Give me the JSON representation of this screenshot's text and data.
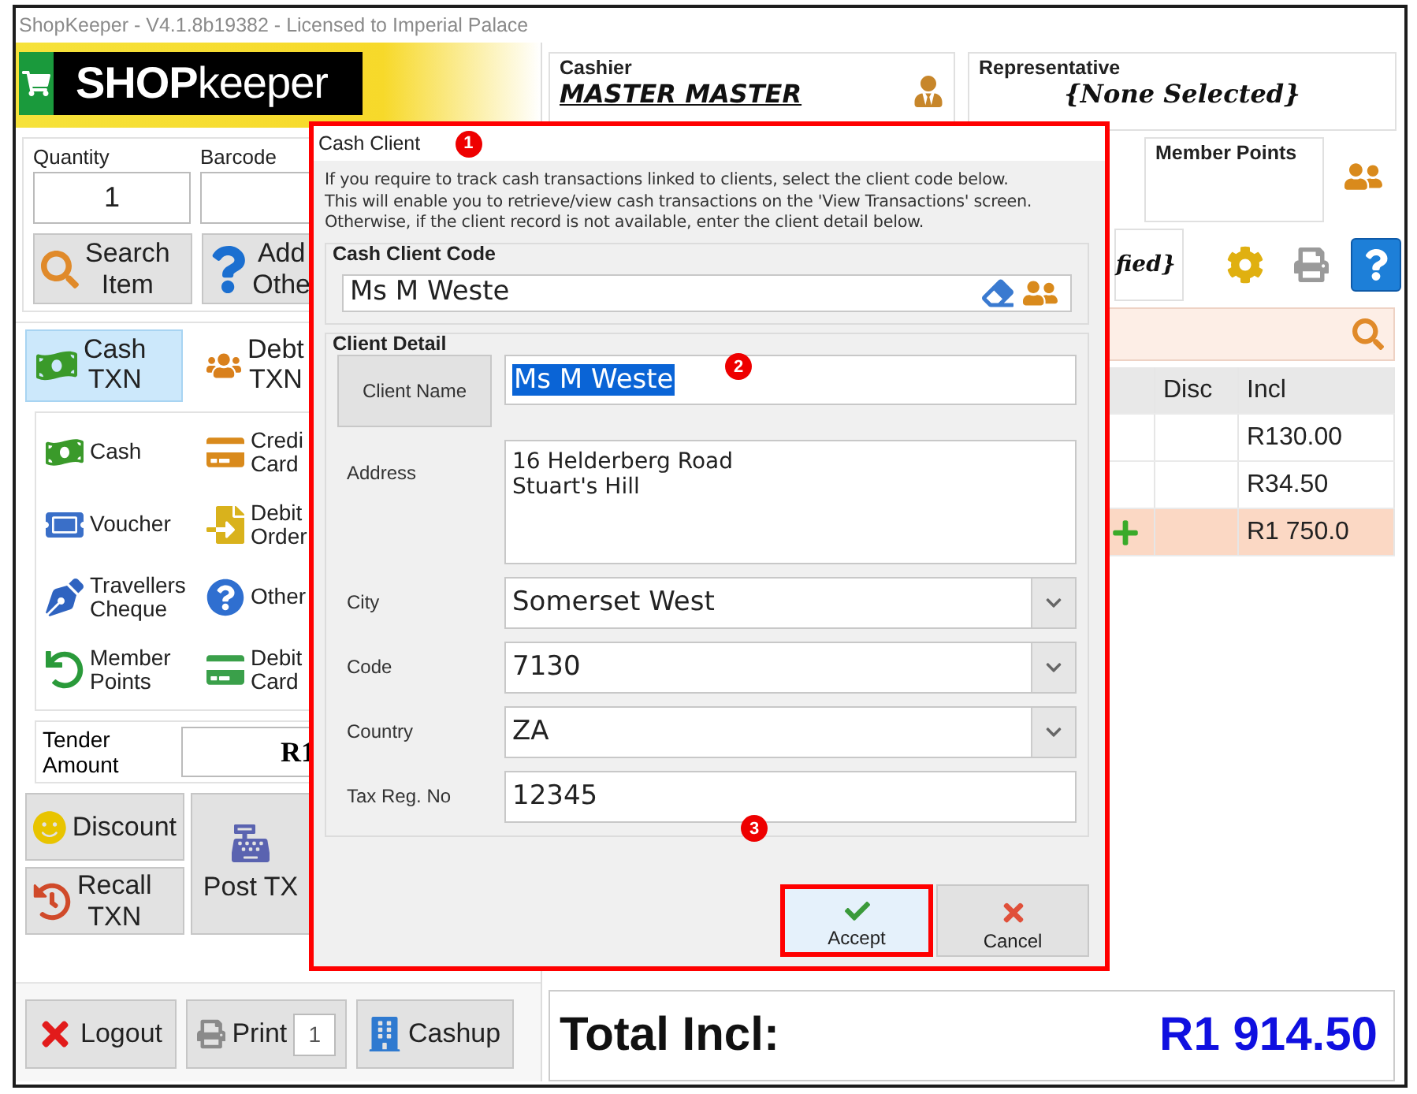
{
  "window": {
    "title": "ShopKeeper - V4.1.8b19382 - Licensed to Imperial Palace"
  },
  "logo": {
    "strong": "SHOP",
    "light": "keeper"
  },
  "cashier": {
    "label": "Cashier",
    "value": "MASTER MASTER"
  },
  "representative": {
    "label": "Representative",
    "value": "{None Selected}"
  },
  "member_points": {
    "label": "Member Points"
  },
  "customer": {
    "value": "fied}"
  },
  "quantity": {
    "label": "Quantity",
    "value": "1"
  },
  "barcode": {
    "label": "Barcode"
  },
  "item_buttons": [
    {
      "kind": "search",
      "lines": [
        "Search",
        "Item"
      ]
    },
    {
      "kind": "help",
      "lines": [
        "Add",
        "Othe"
      ]
    }
  ],
  "txn_tabs": [
    {
      "kind": "cash",
      "lines": [
        "Cash",
        "TXN"
      ],
      "selected": true
    },
    {
      "kind": "debtors",
      "lines": [
        "Debt",
        "TXN"
      ],
      "selected": false
    }
  ],
  "tender_types": [
    {
      "kind": "cash",
      "lines": [
        "Cash"
      ]
    },
    {
      "kind": "credit",
      "lines": [
        "Credi",
        "Card"
      ]
    },
    {
      "kind": "voucher",
      "lines": [
        "Voucher"
      ]
    },
    {
      "kind": "debit_order",
      "lines": [
        "Debit",
        "Order"
      ]
    },
    {
      "kind": "travellers",
      "lines": [
        "Travellers",
        "Cheque"
      ]
    },
    {
      "kind": "other",
      "lines": [
        "Other"
      ]
    },
    {
      "kind": "member",
      "lines": [
        "Member",
        "Points"
      ]
    },
    {
      "kind": "debit_card",
      "lines": [
        "Debit",
        "Card"
      ]
    }
  ],
  "tender_amount": {
    "label_lines": [
      "Tender",
      "Amount"
    ],
    "value": "R1"
  },
  "actions": [
    {
      "kind": "discount",
      "lines": [
        "Discount"
      ]
    },
    {
      "kind": "recall",
      "lines": [
        "Recall",
        "TXN"
      ]
    },
    {
      "kind": "post",
      "lines": [
        "Post TX"
      ]
    }
  ],
  "bottom_buttons": [
    {
      "kind": "logout",
      "label": "Logout"
    },
    {
      "kind": "print",
      "label": "Print",
      "copies": "1"
    },
    {
      "kind": "cashup",
      "label": "Cashup"
    }
  ],
  "table": {
    "columns": [
      "Disc",
      "Incl"
    ],
    "rows": [
      {
        "incl": "R130.00",
        "selected": false,
        "added": false
      },
      {
        "incl": "R34.50",
        "selected": false,
        "added": false
      },
      {
        "incl": "R1 750.0",
        "selected": true,
        "added": true
      }
    ]
  },
  "total": {
    "label": "Total Incl:",
    "value": "R1 914.50"
  },
  "dialog": {
    "title": "Cash Client",
    "description": "If you require to track cash transactions linked to clients, select the client code below.\nThis will enable you to retrieve/view cash transactions on the 'View Transactions' screen.\nOtherwise, if the client record is not available, enter the client detail below.",
    "code_group": {
      "title": "Cash Client Code",
      "value": "Ms M Weste"
    },
    "detail_group": {
      "title": "Client Detail",
      "fields": [
        {
          "kind": "button",
          "label": "Client Name",
          "value": "Ms M Weste",
          "text_selected": true
        },
        {
          "kind": "multiline",
          "label": "Address",
          "value": "16 Helderberg Road\nStuart's Hill"
        },
        {
          "kind": "dropdown",
          "label": "City",
          "value": "Somerset West"
        },
        {
          "kind": "dropdown",
          "label": "Code",
          "value": "7130"
        },
        {
          "kind": "dropdown",
          "label": "Country",
          "value": "ZA"
        },
        {
          "kind": "text",
          "label": "Tax Reg. No",
          "value": "12345"
        }
      ]
    },
    "buttons": [
      {
        "kind": "accept",
        "label": "Accept",
        "highlighted": true
      },
      {
        "kind": "cancel",
        "label": "Cancel",
        "highlighted": false
      }
    ]
  },
  "markers": [
    "1",
    "2",
    "3"
  ]
}
